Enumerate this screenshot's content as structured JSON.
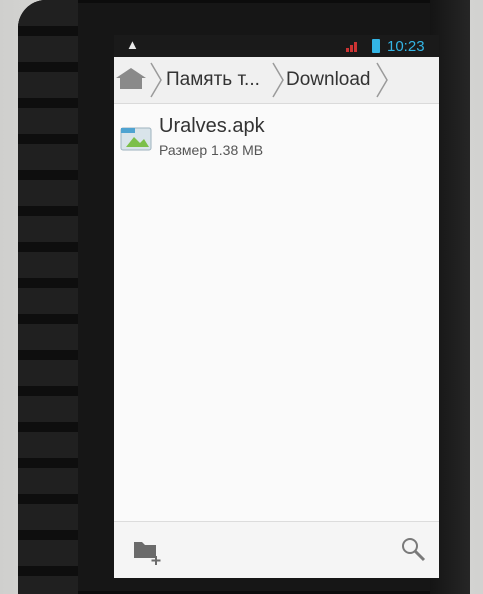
{
  "status_bar": {
    "time": "10:23"
  },
  "breadcrumb": {
    "items": [
      {
        "label": "Память т..."
      },
      {
        "label": "Download"
      }
    ]
  },
  "files": [
    {
      "name": "Uralves.apk",
      "size_text": "Размер 1.38 MB",
      "icon": "apk-file-icon"
    }
  ],
  "colors": {
    "accent": "#33b5e5",
    "status_bg": "#1a1a1a"
  }
}
